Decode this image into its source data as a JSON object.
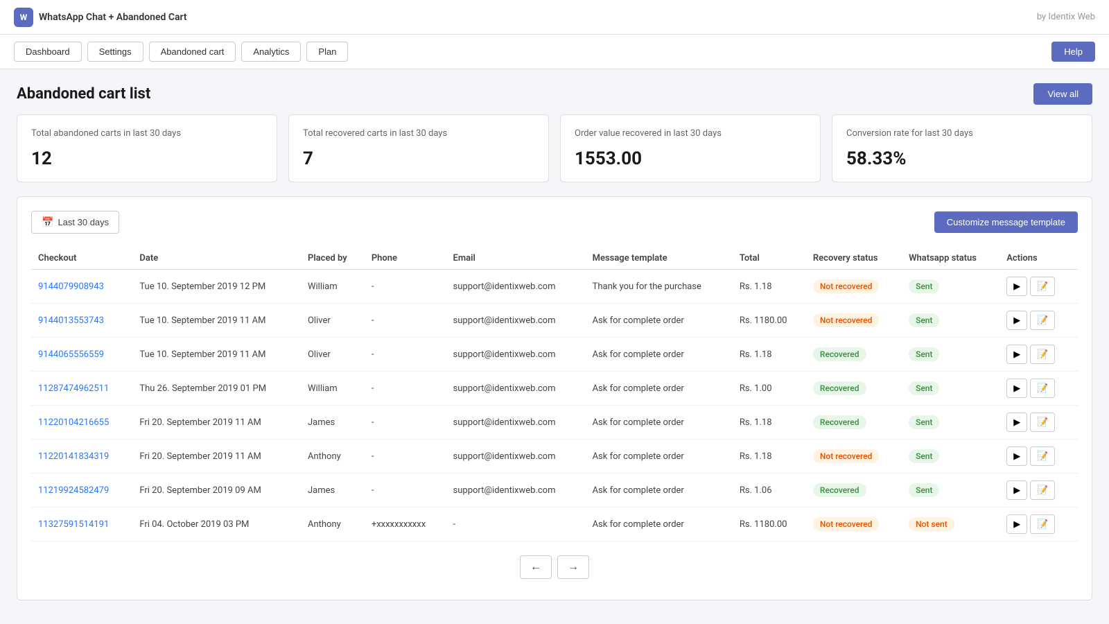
{
  "app": {
    "name": "WhatsApp Chat + Abandoned Cart",
    "logo_text": "W",
    "by_label": "by Identix Web"
  },
  "nav": {
    "tabs": [
      {
        "label": "Dashboard",
        "id": "dashboard"
      },
      {
        "label": "Settings",
        "id": "settings"
      },
      {
        "label": "Abandoned cart",
        "id": "abandoned-cart"
      },
      {
        "label": "Analytics",
        "id": "analytics"
      },
      {
        "label": "Plan",
        "id": "plan"
      }
    ],
    "help_label": "Help"
  },
  "page": {
    "title": "Abandoned cart list",
    "view_all_label": "View all"
  },
  "stats": [
    {
      "label": "Total abandoned carts in last 30 days",
      "value": "12"
    },
    {
      "label": "Total recovered carts in last 30 days",
      "value": "7"
    },
    {
      "label": "Order value recovered in last 30 days",
      "value": "1553.00"
    },
    {
      "label": "Conversion rate for last 30 days",
      "value": "58.33%"
    }
  ],
  "toolbar": {
    "date_filter_label": "Last 30 days",
    "calendar_icon": "📅",
    "customize_btn_label": "Customize message template"
  },
  "table": {
    "columns": [
      "Checkout",
      "Date",
      "Placed by",
      "Phone",
      "Email",
      "Message template",
      "Total",
      "Recovery status",
      "Whatsapp status",
      "Actions"
    ],
    "rows": [
      {
        "checkout": "9144079908943",
        "date": "Tue 10. September 2019 12 PM",
        "placed_by": "William",
        "phone": "-",
        "email": "support@identixweb.com",
        "message_template": "Thank you for the purchase",
        "total": "Rs. 1.18",
        "recovery_status": "Not recovered",
        "recovery_status_type": "not-recovered",
        "whatsapp_status": "Sent",
        "whatsapp_status_type": "sent"
      },
      {
        "checkout": "9144013553743",
        "date": "Tue 10. September 2019 11 AM",
        "placed_by": "Oliver",
        "phone": "-",
        "email": "support@identixweb.com",
        "message_template": "Ask for complete order",
        "total": "Rs. 1180.00",
        "recovery_status": "Not recovered",
        "recovery_status_type": "not-recovered",
        "whatsapp_status": "Sent",
        "whatsapp_status_type": "sent"
      },
      {
        "checkout": "9144065556559",
        "date": "Tue 10. September 2019 11 AM",
        "placed_by": "Oliver",
        "phone": "-",
        "email": "support@identixweb.com",
        "message_template": "Ask for complete order",
        "total": "Rs. 1.18",
        "recovery_status": "Recovered",
        "recovery_status_type": "recovered",
        "whatsapp_status": "Sent",
        "whatsapp_status_type": "sent"
      },
      {
        "checkout": "11287474962511",
        "date": "Thu 26. September 2019 01 PM",
        "placed_by": "William",
        "phone": "-",
        "email": "support@identixweb.com",
        "message_template": "Ask for complete order",
        "total": "Rs. 1.00",
        "recovery_status": "Recovered",
        "recovery_status_type": "recovered",
        "whatsapp_status": "Sent",
        "whatsapp_status_type": "sent"
      },
      {
        "checkout": "11220104216655",
        "date": "Fri 20. September 2019 11 AM",
        "placed_by": "James",
        "phone": "-",
        "email": "support@identixweb.com",
        "message_template": "Ask for complete order",
        "total": "Rs. 1.18",
        "recovery_status": "Recovered",
        "recovery_status_type": "recovered",
        "whatsapp_status": "Sent",
        "whatsapp_status_type": "sent"
      },
      {
        "checkout": "11220141834319",
        "date": "Fri 20. September 2019 11 AM",
        "placed_by": "Anthony",
        "phone": "-",
        "email": "support@identixweb.com",
        "message_template": "Ask for complete order",
        "total": "Rs. 1.18",
        "recovery_status": "Not recovered",
        "recovery_status_type": "not-recovered",
        "whatsapp_status": "Sent",
        "whatsapp_status_type": "sent"
      },
      {
        "checkout": "11219924582479",
        "date": "Fri 20. September 2019 09 AM",
        "placed_by": "James",
        "phone": "-",
        "email": "support@identixweb.com",
        "message_template": "Ask for complete order",
        "total": "Rs. 1.06",
        "recovery_status": "Recovered",
        "recovery_status_type": "recovered",
        "whatsapp_status": "Sent",
        "whatsapp_status_type": "sent"
      },
      {
        "checkout": "11327591514191",
        "date": "Fri 04. October 2019 03 PM",
        "placed_by": "Anthony",
        "phone": "+xxxxxxxxxxx",
        "email": "-",
        "message_template": "Ask for complete order",
        "total": "Rs. 1180.00",
        "recovery_status": "Not recovered",
        "recovery_status_type": "not-recovered",
        "whatsapp_status": "Not sent",
        "whatsapp_status_type": "not-sent"
      }
    ]
  },
  "pagination": {
    "prev_icon": "←",
    "next_icon": "→"
  }
}
